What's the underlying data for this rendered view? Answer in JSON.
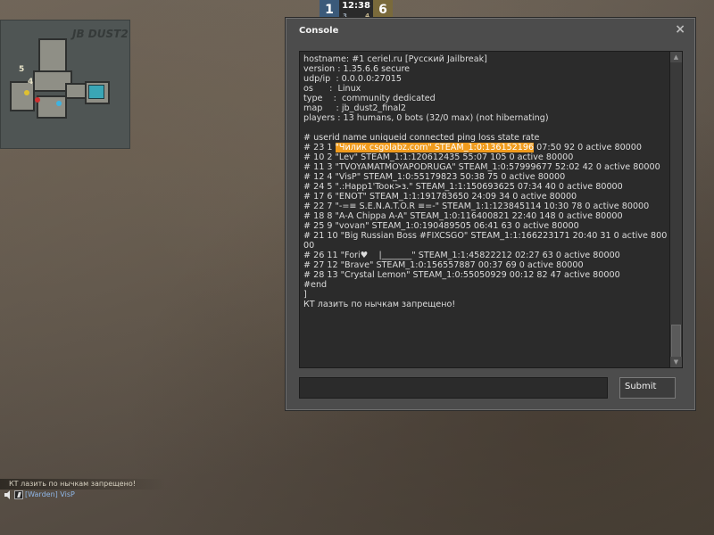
{
  "minimap": {
    "map_label": "JB DUST2",
    "markers": [
      "5",
      "4"
    ]
  },
  "scoreboard": {
    "ct_score": "1",
    "time": "12:38",
    "ct_alive": "3",
    "t_alive": "4",
    "t_score": "6"
  },
  "console": {
    "title": "Console",
    "close_label": "×",
    "submit_label": "Submit",
    "input_value": "",
    "log_lines": [
      "hostname: #1 ceriel.ru [Русский Jailbreak]",
      "version : 1.35.6.6 secure",
      "udp/ip  : 0.0.0.0:27015",
      "os      :  Linux",
      "type    :  community dedicated",
      "map     : jb_dust2_final2",
      "players : 13 humans, 0 bots (32/0 max) (not hibernating)",
      "",
      "# userid name uniqueid connected ping loss state rate",
      "# 23 1 \"Чилик csgolabz.com\" STEAM_1:0:136152196 07:50 92 0 active 80000",
      "# 10 2 \"Lev\" STEAM_1:1:120612435 55:07 105 0 active 80000",
      "# 11 3 \"TVOYAMATMOYAPODRUGA\" STEAM_1:0:57999677 52:02 42 0 active 80000",
      "# 12 4 \"VisP\" STEAM_1:0:55179823 50:38 75 0 active 80000",
      "# 24 5 \".:Happ1'Tooк>з.\" STEAM_1:1:150693625 07:34 40 0 active 80000",
      "# 17 6 \"ENOT\" STEAM_1:1:191783650 24:09 34 0 active 80000",
      "# 22 7 \"-=≡ S.E.N.A.T.O.R ≡=-\" STEAM_1:1:123845114 10:30 78 0 active 80000",
      "# 18 8 \"A-A Chippa A-A\" STEAM_1:0:116400821 22:40 148 0 active 80000",
      "# 25 9 \"vovan\" STEAM_1:0:190489505 06:41 63 0 active 80000",
      "# 21 10 \"Big Russian Boss #FIXCSGO\" STEAM_1:1:166223171 20:40 31 0 active 80000",
      "# 26 11 \"Fori♥    |_______\" STEAM_1:1:45822212 02:27 63 0 active 80000",
      "# 27 12 \"Brave\" STEAM_1:0:156557887 00:37 69 0 active 80000",
      "# 28 13 \"Crystal Lemon\" STEAM_1:0:55050929 00:12 82 47 active 80000",
      "#end",
      "]",
      "КТ лазить по нычкам запрещено!"
    ],
    "highlight_text": "\"Чилик csgolabz.com\" STEAM_1:0:136152196",
    "highlight_color": "#f09b1d"
  },
  "chat": {
    "message": "КТ лазить по нычкам запрещено!",
    "voice_name": "[Warden] VisP"
  }
}
